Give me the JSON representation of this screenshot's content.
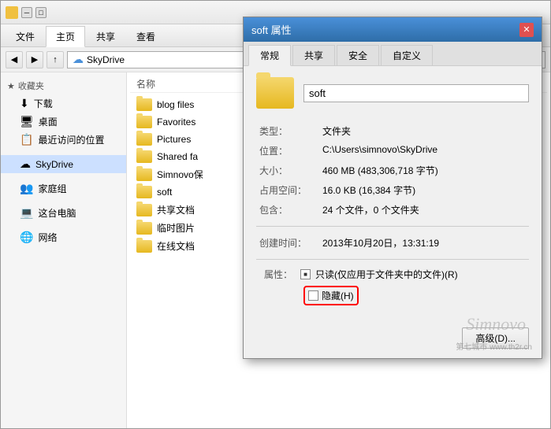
{
  "explorer": {
    "title": "",
    "ribbon_tabs": [
      "文件",
      "主页",
      "共享",
      "查看"
    ],
    "active_tab": "主页",
    "nav_buttons": [
      "←",
      "→",
      "↑"
    ],
    "address_path": "SkyDrive",
    "sidebar": {
      "sections": [
        {
          "title": "收藏夹",
          "items": [
            "下载",
            "桌面",
            "最近访问的位置"
          ]
        }
      ],
      "items": [
        "SkyDrive",
        "家庭组",
        "这台电脑",
        "网络"
      ]
    },
    "file_list_header": "名称",
    "files": [
      "blog files",
      "Favorites",
      "Pictures",
      "Shared fa",
      "Simnovo保",
      "soft",
      "共享文档",
      "临时图片",
      "在线文档"
    ]
  },
  "dialog": {
    "title": "soft 属性",
    "close_label": "✕",
    "tabs": [
      "常规",
      "共享",
      "安全",
      "自定义"
    ],
    "active_tab": "常规",
    "folder_name": "soft",
    "properties": {
      "type_label": "类型：",
      "type_value": "文件夹",
      "location_label": "位置：",
      "location_value": "C:\\Users\\simnovo\\SkyDrive",
      "size_label": "大小：",
      "size_value": "460 MB (483,306,718 字节)",
      "disk_label": "占用空间：",
      "disk_value": "16.0 KB (16,384 字节)",
      "contains_label": "包含：",
      "contains_value": "24 个文件，0 个文件夹",
      "created_label": "创建时间：",
      "created_value": "2013年10月20日，13:31:19"
    },
    "attributes_label": "属性：",
    "attr_readonly_label": "只读(仅应用于文件夹中的文件)(R)",
    "attr_readonly_checked": true,
    "attr_hidden_label": "隐藏(H)",
    "attr_hidden_checked": false,
    "advanced_button": "高级(D)...",
    "watermark": "Simnovo",
    "watermark2": "第七城市  www.th2r.cn"
  }
}
